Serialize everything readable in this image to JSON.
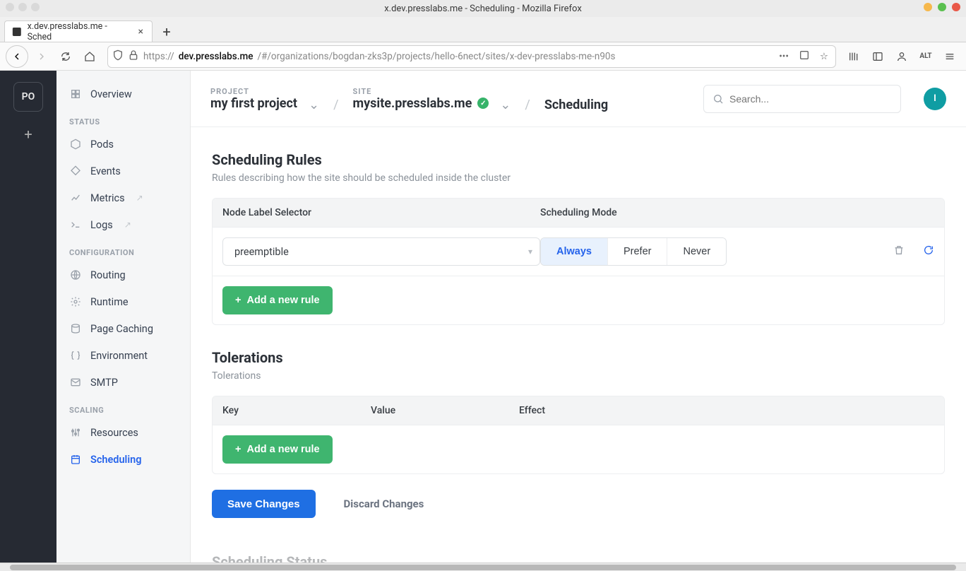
{
  "browser": {
    "window_title": "x.dev.presslabs.me - Scheduling - Mozilla Firefox",
    "tab_title": "x.dev.presslabs.me - Sched",
    "url_proto": "https://",
    "url_domain": "dev.presslabs.me",
    "url_rest": "/#/organizations/bogdan-zks3p/projects/hello-6nect/sites/x-dev-presslabs-me-n90s"
  },
  "rail": {
    "org_initials": "PO"
  },
  "sidebar": {
    "overview": "Overview",
    "sections": {
      "status": "STATUS",
      "configuration": "CONFIGURATION",
      "scaling": "SCALING"
    },
    "items": {
      "pods": "Pods",
      "events": "Events",
      "metrics": "Metrics",
      "logs": "Logs",
      "routing": "Routing",
      "runtime": "Runtime",
      "page_caching": "Page Caching",
      "environment": "Environment",
      "smtp": "SMTP",
      "resources": "Resources",
      "scheduling": "Scheduling"
    }
  },
  "top": {
    "project_label": "PROJECT",
    "project_name": "my first project",
    "site_label": "SITE",
    "site_name": "mysite.presslabs.me",
    "page_title": "Scheduling",
    "search_placeholder": "Search...",
    "user_initial": "I"
  },
  "scheduling_rules": {
    "title": "Scheduling Rules",
    "subtitle": "Rules describing how the site should be scheduled inside the cluster",
    "col_selector": "Node Label Selector",
    "col_mode": "Scheduling Mode",
    "row1_selector": "preemptible",
    "mode_always": "Always",
    "mode_prefer": "Prefer",
    "mode_never": "Never",
    "add_button": "Add a new rule"
  },
  "tolerations": {
    "title": "Tolerations",
    "subtitle": "Tolerations",
    "col_key": "Key",
    "col_value": "Value",
    "col_effect": "Effect",
    "add_button": "Add a new rule"
  },
  "actions": {
    "save": "Save Changes",
    "discard": "Discard Changes"
  },
  "next_section": "Scheduling Status"
}
